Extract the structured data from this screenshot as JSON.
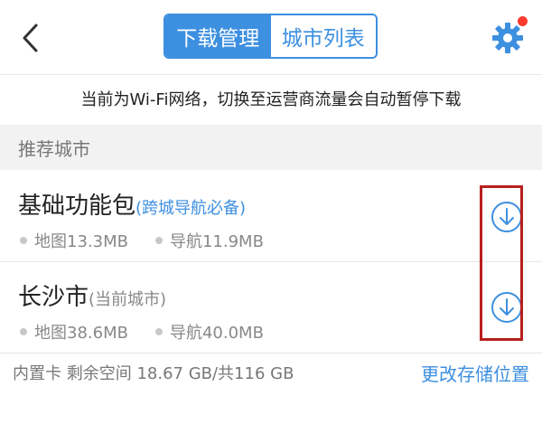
{
  "header": {
    "tabs": [
      {
        "label": "下载管理",
        "active": true
      },
      {
        "label": "城市列表",
        "active": false
      }
    ],
    "settings_has_badge": true
  },
  "notice": "当前为Wi-Fi网络，切换至运营商流量会自动暂停下载",
  "section_title": "推荐城市",
  "items": [
    {
      "name": "基础功能包",
      "tag": "(跨城导航必备)",
      "map_size": "地图13.3MB",
      "nav_size": "导航11.9MB"
    },
    {
      "name": "长沙市",
      "tag": "(当前城市)",
      "map_size": "地图38.6MB",
      "nav_size": "导航40.0MB"
    }
  ],
  "footer": {
    "storage": "内置卡 剩余空间 18.67 GB/共116 GB",
    "change_location": "更改存储位置"
  },
  "colors": {
    "accent": "#3d8fe0",
    "highlight": "#b8201e",
    "badge": "#ff3b30"
  },
  "icons": [
    "back-arrow-icon",
    "gear-icon",
    "download-icon"
  ]
}
